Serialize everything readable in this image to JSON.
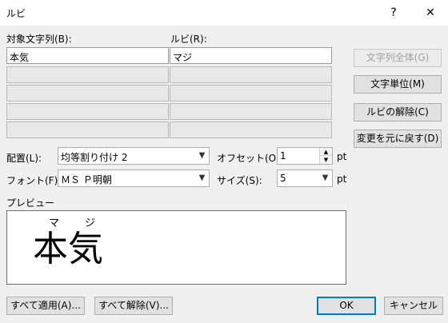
{
  "window": {
    "title": "ルビ",
    "help_glyph": "?",
    "close_glyph": "✕"
  },
  "grid": {
    "target_header": "対象文字列(B):",
    "ruby_header": "ルビ(R):",
    "rows": [
      {
        "target": "本気",
        "ruby": "マジ"
      },
      {
        "target": "",
        "ruby": ""
      },
      {
        "target": "",
        "ruby": ""
      },
      {
        "target": "",
        "ruby": ""
      },
      {
        "target": "",
        "ruby": ""
      }
    ]
  },
  "side_buttons": {
    "whole_string": "文字列全体(G)",
    "per_char": "文字単位(M)",
    "remove_ruby": "ルビの解除(C)",
    "restore": "変更を元に戻す(D)"
  },
  "options": {
    "alignment_label": "配置(L):",
    "alignment_value": "均等割り付け 2",
    "offset_label": "オフセット(O):",
    "offset_value": "1",
    "offset_unit": "pt",
    "font_label": "フォント(F):",
    "font_value": "ＭＳ Ｐ明朝",
    "size_label": "サイズ(S):",
    "size_value": "5",
    "size_unit": "pt"
  },
  "preview": {
    "label": "プレビュー",
    "base_text": "本気",
    "ruby_chars": [
      "マ",
      "ジ"
    ]
  },
  "footer": {
    "apply_all": "すべて適用(A)...",
    "remove_all": "すべて解除(V)...",
    "ok": "OK",
    "cancel": "キャンセル"
  },
  "colors": {
    "dialog_bg": "#f0f0f0",
    "default_button_border": "#0078d7"
  }
}
